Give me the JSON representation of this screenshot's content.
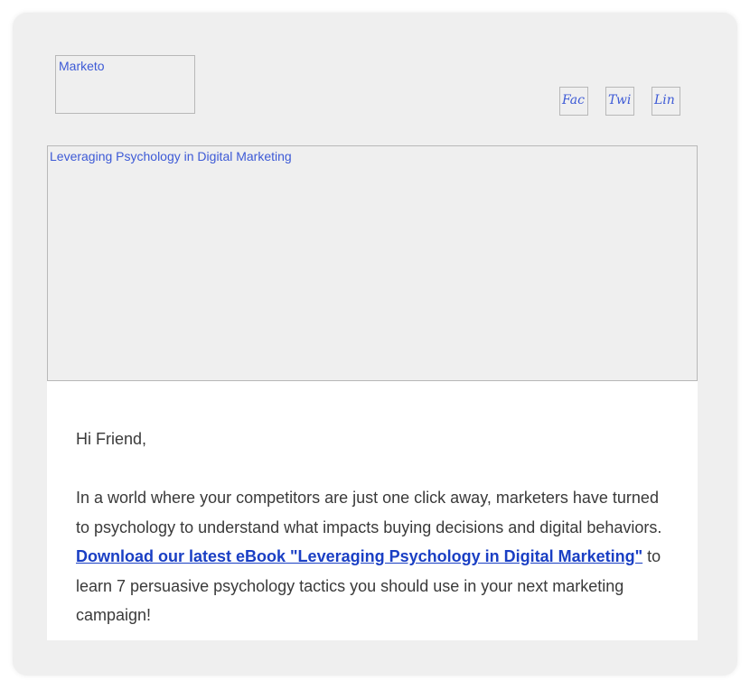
{
  "header": {
    "logo_alt": "Marketo",
    "social": {
      "facebook": "Fac",
      "twitter": "Twi",
      "linkedin": "Lin"
    }
  },
  "hero": {
    "alt": "Leveraging Psychology in Digital Marketing"
  },
  "body": {
    "greeting": "Hi Friend,",
    "paragraph_before": "In a world where your competitors are just one click away, marketers have turned to psychology to understand what impacts buying decisions and digital behaviors. ",
    "link_text": "Download our latest eBook \"Leveraging Psychology in Digital Marketing\"",
    "paragraph_after": " to learn 7 persuasive psychology tactics you should use in your next marketing campaign!"
  },
  "colors": {
    "card_background": "#efefef",
    "alt_text": "#3d5ad6",
    "link": "#1a3fc4",
    "body_text": "#3a3a3a"
  }
}
